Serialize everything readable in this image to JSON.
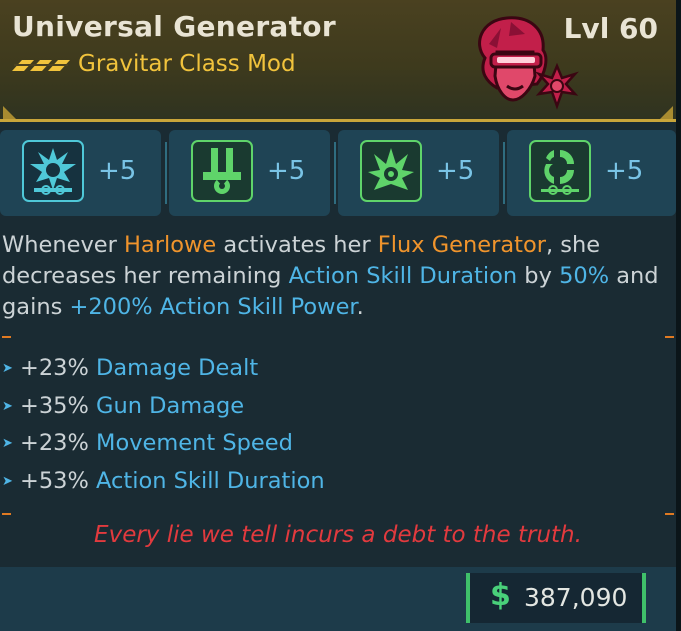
{
  "item": {
    "name": "Universal Generator",
    "level": "Lvl 60",
    "class_mod": "Gravitar Class Mod",
    "rarity_color": "#f1c33c",
    "portrait_icon": "harlowe-portrait-icon"
  },
  "skills": [
    {
      "icon": "flux-burst-icon",
      "value": "+5",
      "color": "#4fc8d8"
    },
    {
      "icon": "radiation-cannon-icon",
      "value": "+5",
      "color": "#5fd46a"
    },
    {
      "icon": "radiation-spike-icon",
      "value": "+5",
      "color": "#5fd46a"
    },
    {
      "icon": "spiral-orbit-icon",
      "value": "+5",
      "color": "#5fd46a"
    }
  ],
  "description": {
    "p1": "Whenever ",
    "name": "Harlowe",
    "p2": " activates her ",
    "skill": "Flux Generator",
    "p3": ", she decreases her remaining ",
    "stat1": "Action Skill Duration",
    "p4": " by ",
    "pct": "50%",
    "p5": " and gains ",
    "bonus": "+200% Action Skill Power",
    "p6": "."
  },
  "stats": [
    {
      "value": "+23%",
      "name": "Damage Dealt"
    },
    {
      "value": "+35%",
      "name": "Gun Damage"
    },
    {
      "value": "+23%",
      "name": "Movement Speed"
    },
    {
      "value": "+53%",
      "name": "Action Skill Duration"
    }
  ],
  "flavor_text": "Every lie we tell incurs a debt to the truth.",
  "price": {
    "symbol": "$",
    "value": "387,090"
  }
}
